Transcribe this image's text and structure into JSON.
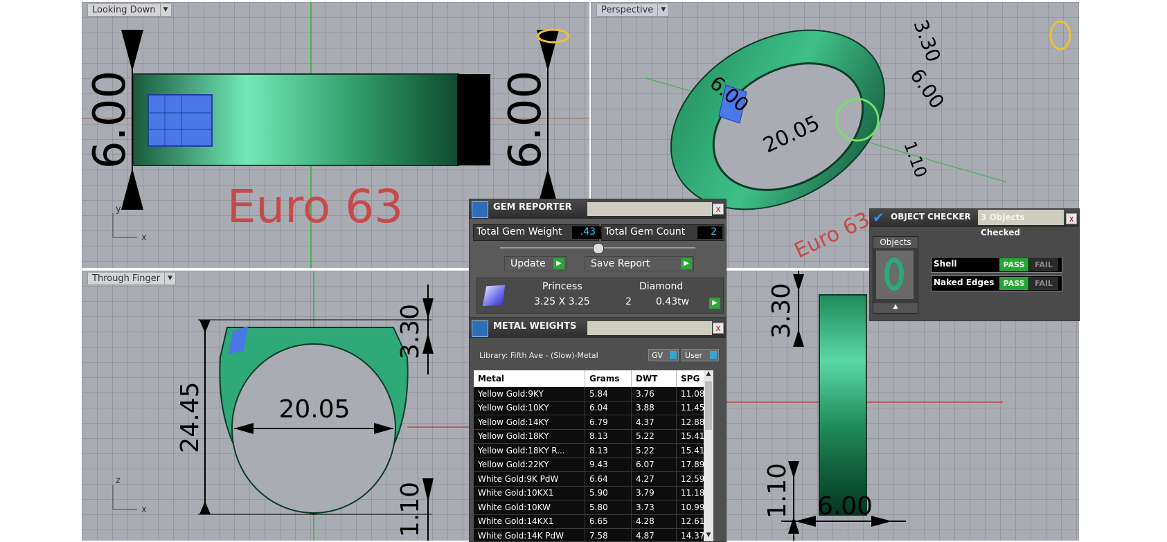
{
  "viewports": {
    "top": {
      "label": "Looking Down",
      "dims": {
        "left": "6.00",
        "right": "6.00"
      },
      "euro_label": "Euro 63",
      "axis_y": "y",
      "axis_x": "x"
    },
    "perspective": {
      "label": "Perspective",
      "dims": {
        "d1": "3.30",
        "d2": "6.00",
        "d3": "6.00",
        "d4": "20.05",
        "d5": "1.10"
      },
      "euro_label": "Euro 63"
    },
    "front": {
      "label": "Through Finger",
      "dims": {
        "top": "3.30",
        "height": "24.45",
        "inner": "20.05",
        "bottom": "1.10"
      },
      "axis_z": "z",
      "axis_x": "x"
    },
    "side": {
      "dims": {
        "top": "3.30",
        "bottom": "1.10",
        "width": "6.00"
      }
    }
  },
  "gem_reporter": {
    "title": "GEM REPORTER",
    "close": "x",
    "total_weight_label": "Total Gem Weight",
    "total_weight_value": ".43",
    "total_count_label": "Total Gem Count",
    "total_count_value": "2",
    "update_label": "Update",
    "save_label": "Save Report",
    "gem": {
      "shape": "Princess",
      "size": "3.25 X 3.25",
      "material": "Diamond",
      "count": "2",
      "weight": "0.43tw"
    }
  },
  "metal_weights": {
    "title": "METAL WEIGHTS",
    "close": "x",
    "library": "Library: Fifth Ave - (Slow)-Metal",
    "gv_label": "GV",
    "user_label": "User",
    "columns": [
      "Metal",
      "Grams",
      "DWT",
      "SPG"
    ],
    "rows": [
      [
        "Yellow Gold:9KY",
        "5.84",
        "3.76",
        "11.08"
      ],
      [
        "Yellow Gold:10KY",
        "6.04",
        "3.88",
        "11.45"
      ],
      [
        "Yellow Gold:14KY",
        "6.79",
        "4.37",
        "12.88"
      ],
      [
        "Yellow Gold:18KY",
        "8.13",
        "5.22",
        "15.41"
      ],
      [
        "Yellow Gold:18KY R...",
        "8.13",
        "5.22",
        "15.41"
      ],
      [
        "Yellow Gold:22KY",
        "9.43",
        "6.07",
        "17.89"
      ],
      [
        "White Gold:9K PdW",
        "6.64",
        "4.27",
        "12.59"
      ],
      [
        "White Gold:10KX1",
        "5.90",
        "3.79",
        "11.18"
      ],
      [
        "White Gold:10KW",
        "5.80",
        "3.73",
        "10.99"
      ],
      [
        "White Gold:14KX1",
        "6.65",
        "4.28",
        "12.61"
      ],
      [
        "White Gold:14K PdW",
        "7.58",
        "4.87",
        "14.37"
      ]
    ]
  },
  "object_checker": {
    "title": "OBJECT CHECKER",
    "status": "3  Objects Checked",
    "close": "x",
    "objects_label": "Objects",
    "scroll_up": "▲",
    "checks": [
      {
        "name": "Shell",
        "pass": "PASS",
        "fail": "FAIL"
      },
      {
        "name": "Naked Edges",
        "pass": "PASS",
        "fail": "FAIL"
      }
    ]
  },
  "colors": {
    "ring_green": "#2fa87a",
    "gem_blue": "#3f6fd8",
    "pass_green": "#2aa33a",
    "euro_red": "#c64a4a",
    "value_cyan": "#37d0f0"
  }
}
